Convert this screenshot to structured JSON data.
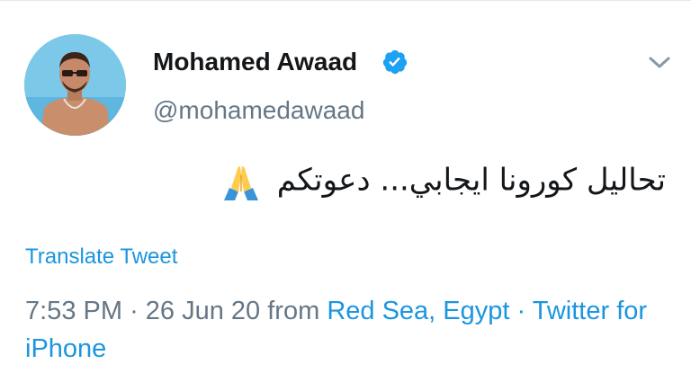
{
  "author": {
    "name": "Mohamed Awaad",
    "handle": "@mohamedawaad",
    "verified": true,
    "verified_color": "#1da1f2"
  },
  "tweet": {
    "text": "تحاليل كورونا ايجابي... دعوتكم",
    "emoji": "folded-hands-emoji",
    "translate_label": "Translate Tweet",
    "time": "7:53 PM",
    "sep1": "·",
    "date": "26 Jun 20",
    "from_label": "from",
    "location": "Red Sea, Egypt",
    "sep2": "·",
    "source": "Twitter for iPhone"
  },
  "colors": {
    "link": "#1b95e0",
    "text": "#14171a",
    "muted": "#657786"
  },
  "icons": {
    "menu": "chevron-down-icon",
    "verified": "verified-badge-icon"
  }
}
